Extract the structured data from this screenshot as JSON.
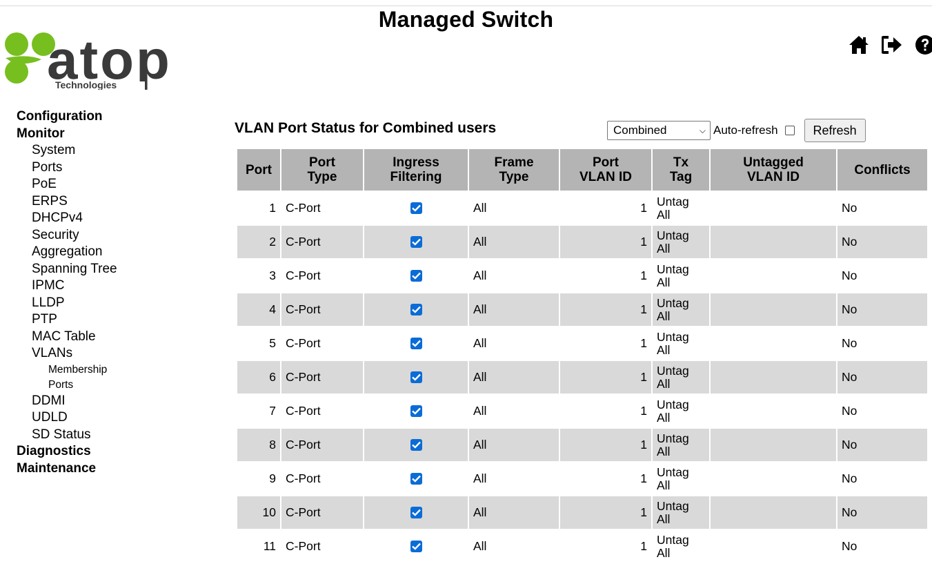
{
  "header": {
    "title": "Managed Switch",
    "logo_text": "atop",
    "logo_subtext": "Technologies",
    "icons": [
      "home-icon",
      "logout-icon",
      "help-icon"
    ]
  },
  "colors": {
    "logo_green": "#77bf1f",
    "header_row": "#b4b4b4",
    "even_row": "#d9d9d9",
    "checkbox": "#0b6cd6"
  },
  "nav": {
    "configuration": "Configuration",
    "monitor": "Monitor",
    "monitor_items": [
      "System",
      "Ports",
      "PoE",
      "ERPS",
      "DHCPv4",
      "Security",
      "Aggregation",
      "Spanning Tree",
      "IPMC",
      "LLDP",
      "PTP",
      "MAC Table",
      "VLANs"
    ],
    "vlan_items": [
      "Membership",
      "Ports"
    ],
    "monitor_items_after": [
      "DDMI",
      "UDLD",
      "SD Status"
    ],
    "diagnostics": "Diagnostics",
    "maintenance": "Maintenance"
  },
  "page": {
    "heading": "VLAN Port Status for Combined users",
    "user_select": "Combined",
    "auto_refresh_label": "Auto-refresh",
    "auto_refresh_checked": false,
    "refresh_button": "Refresh"
  },
  "table": {
    "headers": {
      "port": "Port",
      "port_type_1": "Port",
      "port_type_2": "Type",
      "ingress_1": "Ingress",
      "ingress_2": "Filtering",
      "frame_1": "Frame",
      "frame_2": "Type",
      "pvid_1": "Port",
      "pvid_2": "VLAN ID",
      "tx_1": "Tx",
      "tx_2": "Tag",
      "untagged_1": "Untagged",
      "untagged_2": "VLAN ID",
      "conflicts": "Conflicts"
    },
    "rows": [
      {
        "port": "1",
        "port_type": "C-Port",
        "ingress": true,
        "frame_type": "All",
        "pvid": "1",
        "tx_tag_1": "Untag",
        "tx_tag_2": "All",
        "untagged_vid": "",
        "conflicts": "No"
      },
      {
        "port": "2",
        "port_type": "C-Port",
        "ingress": true,
        "frame_type": "All",
        "pvid": "1",
        "tx_tag_1": "Untag",
        "tx_tag_2": "All",
        "untagged_vid": "",
        "conflicts": "No"
      },
      {
        "port": "3",
        "port_type": "C-Port",
        "ingress": true,
        "frame_type": "All",
        "pvid": "1",
        "tx_tag_1": "Untag",
        "tx_tag_2": "All",
        "untagged_vid": "",
        "conflicts": "No"
      },
      {
        "port": "4",
        "port_type": "C-Port",
        "ingress": true,
        "frame_type": "All",
        "pvid": "1",
        "tx_tag_1": "Untag",
        "tx_tag_2": "All",
        "untagged_vid": "",
        "conflicts": "No"
      },
      {
        "port": "5",
        "port_type": "C-Port",
        "ingress": true,
        "frame_type": "All",
        "pvid": "1",
        "tx_tag_1": "Untag",
        "tx_tag_2": "All",
        "untagged_vid": "",
        "conflicts": "No"
      },
      {
        "port": "6",
        "port_type": "C-Port",
        "ingress": true,
        "frame_type": "All",
        "pvid": "1",
        "tx_tag_1": "Untag",
        "tx_tag_2": "All",
        "untagged_vid": "",
        "conflicts": "No"
      },
      {
        "port": "7",
        "port_type": "C-Port",
        "ingress": true,
        "frame_type": "All",
        "pvid": "1",
        "tx_tag_1": "Untag",
        "tx_tag_2": "All",
        "untagged_vid": "",
        "conflicts": "No"
      },
      {
        "port": "8",
        "port_type": "C-Port",
        "ingress": true,
        "frame_type": "All",
        "pvid": "1",
        "tx_tag_1": "Untag",
        "tx_tag_2": "All",
        "untagged_vid": "",
        "conflicts": "No"
      },
      {
        "port": "9",
        "port_type": "C-Port",
        "ingress": true,
        "frame_type": "All",
        "pvid": "1",
        "tx_tag_1": "Untag",
        "tx_tag_2": "All",
        "untagged_vid": "",
        "conflicts": "No"
      },
      {
        "port": "10",
        "port_type": "C-Port",
        "ingress": true,
        "frame_type": "All",
        "pvid": "1",
        "tx_tag_1": "Untag",
        "tx_tag_2": "All",
        "untagged_vid": "",
        "conflicts": "No"
      },
      {
        "port": "11",
        "port_type": "C-Port",
        "ingress": true,
        "frame_type": "All",
        "pvid": "1",
        "tx_tag_1": "Untag",
        "tx_tag_2": "All",
        "untagged_vid": "",
        "conflicts": "No"
      }
    ]
  }
}
